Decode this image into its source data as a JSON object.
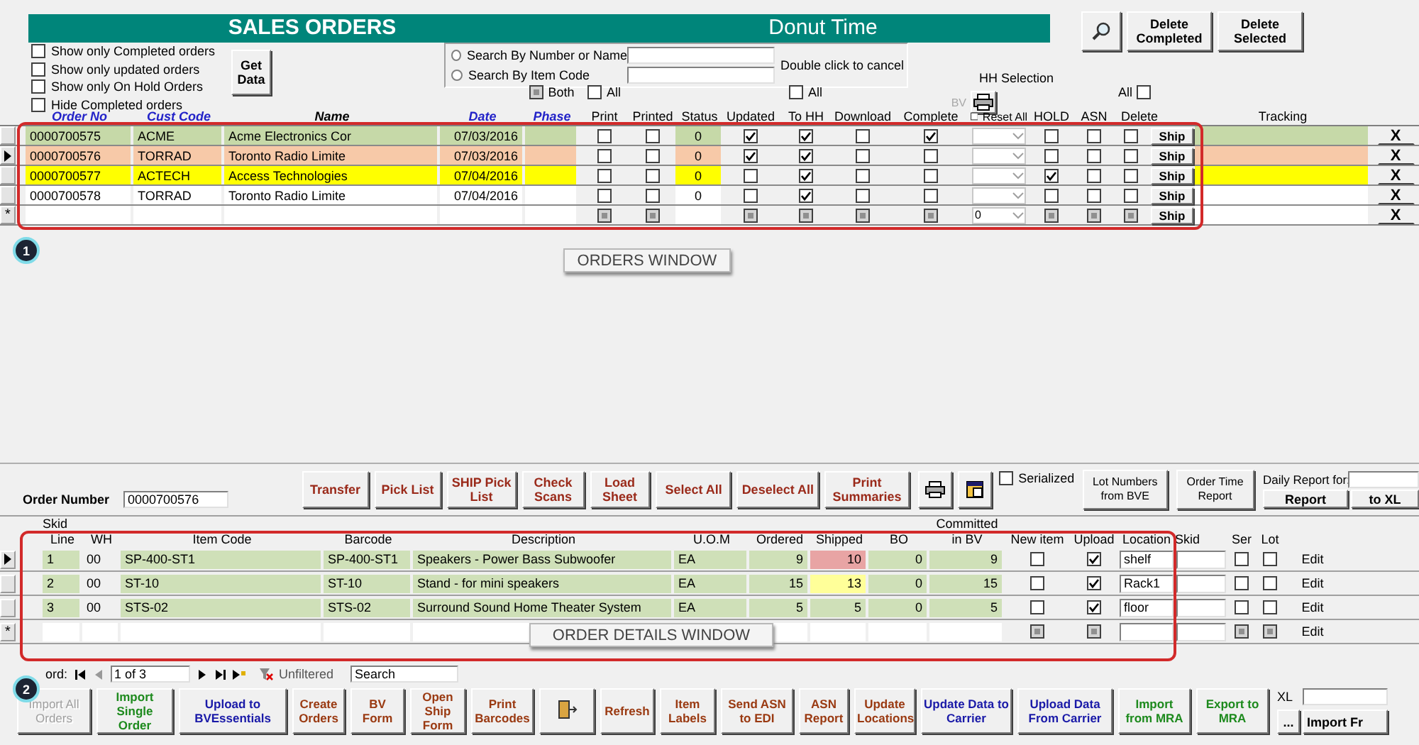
{
  "header": {
    "title": "SALES ORDERS",
    "company": "Donut Time"
  },
  "top_buttons": [
    {
      "label": "Delete Completed"
    },
    {
      "label": "Delete Selected"
    }
  ],
  "filters": [
    {
      "label": "Show only Completed orders",
      "checked": false
    },
    {
      "label": "Show only updated orders",
      "checked": false
    },
    {
      "label": "Show only On Hold Orders",
      "checked": false
    },
    {
      "label": "Hide Completed orders",
      "checked": false
    }
  ],
  "get_data": "Get Data",
  "search": {
    "options": [
      {
        "label": "Search By Number or Name",
        "selected": false
      },
      {
        "label": "Search By Item Code",
        "selected": false
      }
    ],
    "hint": "Double click to cancel"
  },
  "hh_selection": "HH Selection",
  "bv_label": "BV",
  "toggles": [
    {
      "label": "Both",
      "mixed": true
    },
    {
      "label": "All",
      "checked": false
    },
    {
      "label": "All",
      "checked": false
    },
    {
      "label": "All",
      "checked": false
    }
  ],
  "orders": {
    "columns": [
      {
        "label": "Order No",
        "kind": "link"
      },
      {
        "label": "Cust Code",
        "kind": "link"
      },
      {
        "label": "Name",
        "kind": "bold"
      },
      {
        "label": "Date",
        "kind": "link"
      },
      {
        "label": "Phase",
        "kind": "link"
      },
      {
        "label": "Print",
        "kind": "plain"
      },
      {
        "label": "Printed",
        "kind": "plain"
      },
      {
        "label": "Status",
        "kind": "plain"
      },
      {
        "label": "Updated",
        "kind": "plain"
      },
      {
        "label": "To HH",
        "kind": "plain"
      },
      {
        "label": "Download",
        "kind": "plain"
      },
      {
        "label": "Complete",
        "kind": "plain"
      },
      {
        "label": "Reset All",
        "kind": "check",
        "checked": false
      },
      {
        "label": "HOLD",
        "kind": "plain"
      },
      {
        "label": "ASN",
        "kind": "plain"
      },
      {
        "label": "Delete",
        "kind": "plain"
      },
      {
        "label": "Tracking",
        "kind": "plain"
      }
    ],
    "rows": [
      {
        "kind": "order",
        "current": false,
        "order_no": "0000700575",
        "cust_code": "ACME",
        "name": "Acme Electronics Cor",
        "date": "07/03/2016",
        "status": "0",
        "color": "#c6d9a8",
        "print": false,
        "printed": false,
        "updated": true,
        "to_hh": true,
        "download": false,
        "complete": true,
        "hold": false,
        "asn": false,
        "delete": false,
        "ship": "Ship",
        "remove": "X"
      },
      {
        "kind": "order",
        "current": true,
        "order_no": "0000700576",
        "cust_code": "TORRAD",
        "name": "Toronto Radio Limite",
        "date": "07/03/2016",
        "status": "0",
        "color": "#f7c9a8",
        "print": false,
        "printed": false,
        "updated": true,
        "to_hh": true,
        "download": false,
        "complete": false,
        "hold": false,
        "asn": false,
        "delete": false,
        "ship": "Ship",
        "remove": "X"
      },
      {
        "kind": "order",
        "current": false,
        "order_no": "0000700577",
        "cust_code": "ACTECH",
        "name": "Access Technologies",
        "date": "07/04/2016",
        "status": "0",
        "color": "#ffff00",
        "print": false,
        "printed": false,
        "updated": false,
        "to_hh": true,
        "download": false,
        "complete": false,
        "hold": true,
        "asn": false,
        "delete": false,
        "ship": "Ship",
        "remove": "X"
      },
      {
        "kind": "order",
        "current": false,
        "order_no": "0000700578",
        "cust_code": "TORRAD",
        "name": "Toronto Radio Limite",
        "date": "07/04/2016",
        "status": "0",
        "color": "#ffffff",
        "print": false,
        "printed": false,
        "updated": false,
        "to_hh": true,
        "download": false,
        "complete": false,
        "hold": false,
        "asn": false,
        "delete": false,
        "ship": "Ship",
        "remove": "X"
      },
      {
        "kind": "new",
        "marker": "*",
        "mixed": true,
        "hh": "0",
        "ship": "Ship",
        "remove": "X"
      }
    ]
  },
  "annotations": [
    {
      "marker": "1",
      "label": "ORDERS WINDOW"
    },
    {
      "marker": "2",
      "label": "ORDER DETAILS  WINDOW"
    }
  ],
  "order_number": {
    "label": "Order Number",
    "value": "0000700576"
  },
  "toolbar": [
    {
      "label": "Transfer"
    },
    {
      "label": "Pick List"
    },
    {
      "label": "SHIP Pick List"
    },
    {
      "label": "Check Scans"
    },
    {
      "label": "Load Sheet"
    },
    {
      "label": "Select All"
    },
    {
      "label": "Deselect All"
    },
    {
      "label": "Print Summaries"
    }
  ],
  "serialized": {
    "label": "Serialized",
    "checked": false
  },
  "side_buttons": [
    {
      "label": "Lot Numbers from BVE"
    },
    {
      "label": "Order Time Report"
    }
  ],
  "daily_report": {
    "label": "Daily Report for:",
    "report": "Report",
    "to_xl": "to XL"
  },
  "details": {
    "skid_label": "Skid",
    "committed_label": "Committed",
    "columns": [
      "Line",
      "WH",
      "Item Code",
      "Barcode",
      "Description",
      "U.O.M",
      "Ordered",
      "Shipped",
      "BO",
      "in BV",
      "New item",
      "Upload",
      "Location",
      "Skid",
      "Ser",
      "Lot"
    ],
    "rows": [
      {
        "kind": "item",
        "current": true,
        "line": "1",
        "wh": "00",
        "item_code": "SP-400-ST1",
        "barcode": "SP-400-ST1",
        "description": "Speakers - Power Bass Subwoofer",
        "uom": "EA",
        "ordered": "9",
        "shipped": "10",
        "color": "#e8a4a4",
        "bo": "0",
        "in_bv": "9",
        "new_item": false,
        "upload": true,
        "location": "shelf",
        "ser": false,
        "lot": false,
        "edit": "Edit"
      },
      {
        "kind": "item",
        "current": false,
        "line": "2",
        "wh": "00",
        "item_code": "ST-10",
        "barcode": "ST-10",
        "description": "Stand - for mini speakers",
        "uom": "EA",
        "ordered": "15",
        "shipped": "13",
        "color": "#ffff99",
        "bo": "0",
        "in_bv": "15",
        "new_item": false,
        "upload": true,
        "location": "Rack1",
        "ser": false,
        "lot": false,
        "edit": "Edit"
      },
      {
        "kind": "item",
        "current": false,
        "line": "3",
        "wh": "00",
        "item_code": "STS-02",
        "barcode": "STS-02",
        "description": "Surround Sound Home Theater System",
        "uom": "EA",
        "ordered": "5",
        "shipped": "5",
        "color": "#cfe0b8",
        "bo": "0",
        "in_bv": "5",
        "new_item": false,
        "upload": true,
        "location": "floor",
        "ser": false,
        "lot": false,
        "edit": "Edit"
      },
      {
        "kind": "new",
        "marker": "*",
        "mixed": true,
        "edit": "Edit"
      }
    ]
  },
  "navigation": {
    "label": "ord:",
    "position": "1 of 3",
    "filter": "Unfiltered",
    "search": "Search"
  },
  "bottom_buttons": [
    {
      "label": "Import All Orders",
      "color": "#a0a0a0",
      "disabled": true
    },
    {
      "label": "Import Single Order",
      "color": "#1e8a1e",
      "disabled": false
    },
    {
      "label": "Upload to BVEssentials",
      "color": "#1a1aa8",
      "disabled": false
    },
    {
      "label": "Create Orders",
      "color": "#9a3a12",
      "disabled": false
    },
    {
      "label": "BV Form",
      "color": "#9a3a12",
      "disabled": false
    },
    {
      "label": "Open Ship Form",
      "color": "#9a3a12",
      "disabled": false
    },
    {
      "label": "Print Barcodes",
      "color": "#9a3a12",
      "disabled": false
    },
    {
      "kind": "icon",
      "disabled": false
    },
    {
      "label": "Refresh",
      "color": "#9a3a12",
      "disabled": false
    },
    {
      "label": "Item Labels",
      "color": "#9a3a12",
      "disabled": false
    },
    {
      "label": "Send ASN to EDI",
      "color": "#9a3a12",
      "disabled": false
    },
    {
      "label": "ASN Report",
      "color": "#9a3a12",
      "disabled": false
    },
    {
      "label": "Update Locations",
      "color": "#9a3a12",
      "disabled": false
    },
    {
      "label": "Update Data to Carrier",
      "color": "#1a1aa8",
      "disabled": false
    },
    {
      "label": "Upload Data From Carrier",
      "color": "#1a1aa8",
      "disabled": false
    },
    {
      "label": "Import from MRA",
      "color": "#1e8a1e",
      "disabled": false
    },
    {
      "label": "Export to MRA",
      "color": "#1e8a1e",
      "disabled": false
    }
  ],
  "xl": {
    "label": "XL",
    "browse": "...",
    "import": "Import Fr"
  }
}
